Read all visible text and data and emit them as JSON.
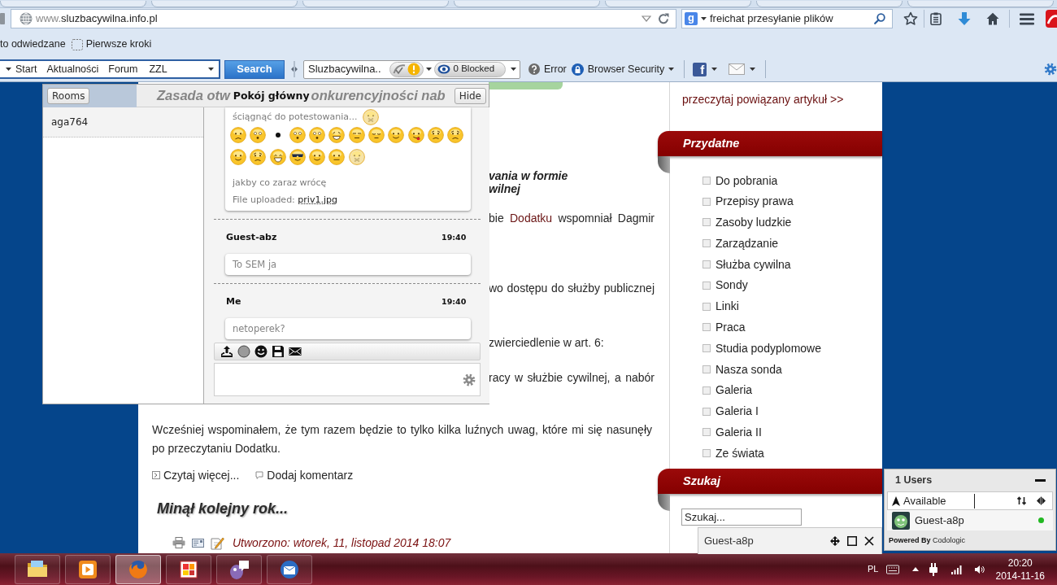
{
  "browser": {
    "url": {
      "prefix": "www.",
      "host": "sluzbacywilna.info.pl"
    },
    "search": {
      "engine_letter": "g",
      "value": "freichat przesyłanie plików"
    },
    "bookmarks": [
      {
        "kind": "plain",
        "label": "to odwiedzane"
      },
      {
        "kind": "page",
        "label": "Pierwsze kroki"
      }
    ],
    "toolbar": {
      "links": [
        "Start",
        "Aktualności",
        "Forum"
      ],
      "query": "ZZL",
      "search_button": "Search",
      "site": "Sluzbacywilna..",
      "blocked": "0 Blocked",
      "items": [
        {
          "kind": "error",
          "label": "Error"
        },
        {
          "kind": "security",
          "label": "Browser Security"
        }
      ],
      "share_letter": "f"
    }
  },
  "chat": {
    "rooms_button": "Rooms",
    "users": [
      "aga764"
    ],
    "title": "Pokój główny",
    "hide_button": "Hide",
    "messages": [
      {
        "parts": [
          {
            "kind": "text_emoticon",
            "text": "ściągnąć do potestowania..."
          },
          {
            "kind": "emoticons"
          },
          {
            "kind": "text",
            "text": "jakby co zaraz wrócę"
          },
          {
            "kind": "file",
            "label": "File uploaded:",
            "file": "priv1.jpg"
          }
        ]
      },
      {
        "sender": "Guest-abz",
        "time": "19:40",
        "parts": [
          {
            "kind": "text",
            "text": "To SEM ja"
          }
        ]
      },
      {
        "sender": "Me",
        "time": "19:40",
        "parts": [
          {
            "kind": "text",
            "text": "netoperek?"
          }
        ]
      }
    ]
  },
  "article": {
    "heading_fragments": [
      "Zasada otw",
      "onkurencyjności nab"
    ],
    "subheading_fragments": [
      "vania w formie",
      "wilnej"
    ],
    "line_fragments": [
      {
        "kind": "full_line",
        "text": "bie",
        "link": "Dodatku",
        "after": "wspomniał Dagmir"
      },
      {
        "kind": "full_line",
        "text": "wo dostępu do służby publicznej"
      },
      {
        "kind": "end_line",
        "text": "zwierciedlenie w art. 6:"
      },
      {
        "kind": "full_line",
        "text": "racy w służbie cywilnej, a nabór"
      }
    ],
    "paragraph": "Wcześniej wspominałem, że tym razem będzie to tylko kilka luźnych uwag, które mi się nasunęły po przeczytaniu Dodatku.",
    "read_more": "Czytaj więcej...",
    "comment": "Dodaj komentarz",
    "next_title": "Minął kolejny rok...",
    "created": "Utworzono: wtorek, 11, listopad 2014 18:07"
  },
  "sidebar": {
    "related_link": "przeczytaj powiązany artykuł >>",
    "sections": [
      {
        "kind": "links",
        "title": "Przydatne",
        "items": [
          "Do pobrania",
          "Przepisy prawa",
          "Zasoby ludzkie",
          "Zarządzanie",
          "Służba cywilna",
          "Sondy",
          "Linki",
          "Praca",
          "Studia podyplomowe",
          "Nasza sonda",
          "Galeria",
          "Galeria I",
          "Galeria II",
          "Ze świata"
        ]
      },
      {
        "kind": "search",
        "title": "Szukaj",
        "value": "Szukaj..."
      }
    ]
  },
  "chat_tab": {
    "name": "Guest-a8p"
  },
  "users_panel": {
    "title": "1 Users",
    "status": "Available",
    "users": [
      {
        "name": "Guest-a8p",
        "online": true
      }
    ],
    "powered_by": "Powered By",
    "brand": "Codologic"
  },
  "taskbar": {
    "apps": [
      {
        "selected": false
      },
      {
        "selected": false
      },
      {
        "selected": true
      },
      {
        "selected": false
      },
      {
        "selected": false
      },
      {
        "selected": false
      }
    ],
    "language": "PL",
    "time": "20:20",
    "date": "2014-11-16"
  }
}
